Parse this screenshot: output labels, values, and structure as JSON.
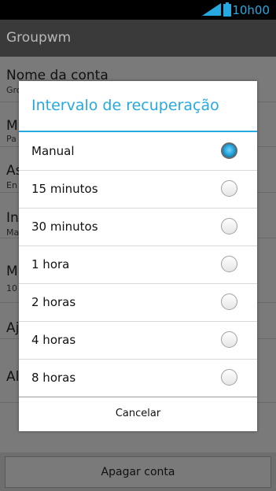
{
  "status_bar": {
    "time": "10h00",
    "accent": "#26a9e0",
    "icons": [
      "signal-icon",
      "battery-icon"
    ]
  },
  "action_bar": {
    "title": "Groupwm"
  },
  "settings": {
    "rows": [
      {
        "title": "Nome da conta",
        "subtitle": "Gro"
      },
      {
        "title": "M",
        "subtitle": "Pa"
      },
      {
        "title": "As",
        "subtitle": "En"
      },
      {
        "title": "Int",
        "subtitle": "Ma"
      },
      {
        "title": "M",
        "subtitle": "10"
      },
      {
        "title": "Aj",
        "subtitle": ""
      },
      {
        "title": "Al",
        "subtitle": ""
      }
    ],
    "delete_button": "Apagar conta"
  },
  "dialog": {
    "title": "Intervalo de recuperação",
    "selected_option": "Manual",
    "options": [
      {
        "label": "Manual"
      },
      {
        "label": "15 minutos"
      },
      {
        "label": "30 minutos"
      },
      {
        "label": "1 hora"
      },
      {
        "label": "2 horas"
      },
      {
        "label": "4 horas"
      },
      {
        "label": "8 horas"
      }
    ],
    "cancel_label": "Cancelar"
  }
}
